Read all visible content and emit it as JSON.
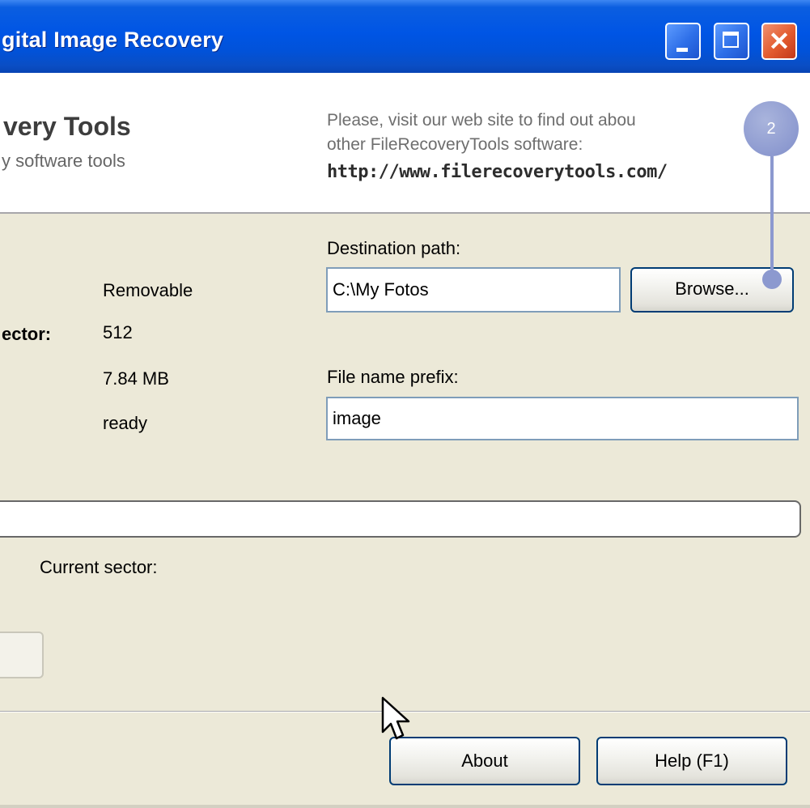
{
  "window": {
    "title": "gital Image Recovery",
    "buttons": [
      "minimize",
      "maximize",
      "close"
    ]
  },
  "banner": {
    "brand_name": "very Tools",
    "brand_tagline": "y software tools",
    "visit_line1": "Please, visit our web site to find out abou",
    "visit_line2": "other FileRecoveryTools software:",
    "url": "http://www.filerecoverytools.com/"
  },
  "device_info": {
    "type_value": "Removable",
    "bytes_per_sector_label": "ector:",
    "bytes_per_sector_value": "512",
    "size_value": "7.84 MB",
    "status_value": "ready"
  },
  "destination": {
    "label": "Destination path:",
    "value": "C:\\My Fotos",
    "browse_label": "Browse..."
  },
  "prefix": {
    "label": "File name prefix:",
    "value": "image"
  },
  "progress": {
    "current_sector_label": "Current sector:",
    "fraction": 0
  },
  "footer": {
    "about_label": "About",
    "help_label": "Help (F1)"
  },
  "callout": {
    "number": "2",
    "color": "#8d9ad0"
  },
  "colors": {
    "titlebar": "#0055e5",
    "window_bg": "#ece9d8",
    "button_border": "#003c74"
  }
}
